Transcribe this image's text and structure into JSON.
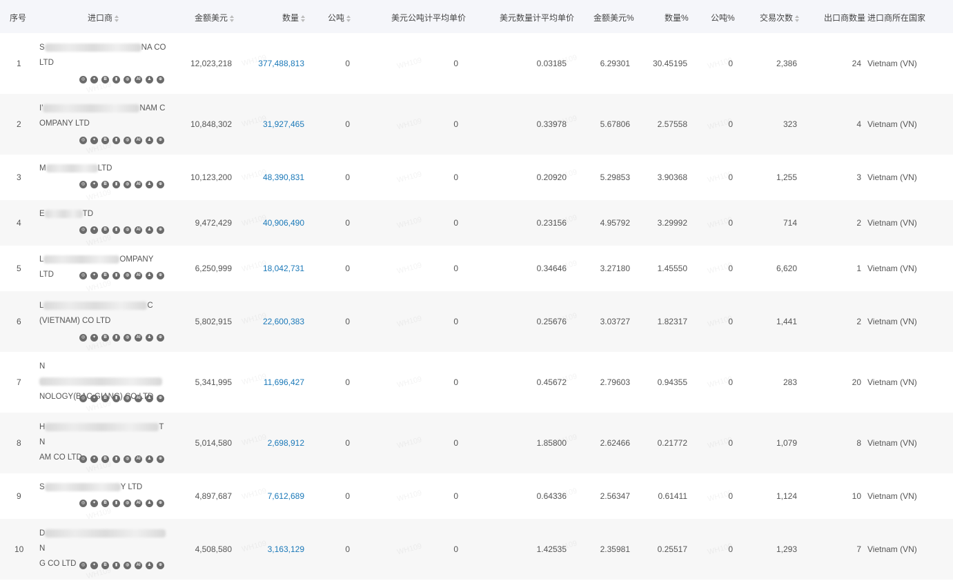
{
  "headers": {
    "idx": "序号",
    "importer": "进口商",
    "amount_usd": "金额美元",
    "quantity": "数量",
    "ton": "公吨",
    "usd_per_ton": "美元公吨计平均单价",
    "usd_per_qty": "美元数量计平均单价",
    "amount_pct": "金额美元%",
    "qty_pct": "数量%",
    "ton_pct": "公吨%",
    "trades": "交易次数",
    "exporters": "出口商数量",
    "country": "进口商所在国家"
  },
  "icon_names": [
    "locate-icon",
    "target-icon",
    "b-icon",
    "doc-icon",
    "globe-icon",
    "ai-icon",
    "users-icon",
    "web-icon"
  ],
  "watermark": "WH109",
  "rows": [
    {
      "idx": "1",
      "name1": "S",
      "name1b": "NA CO",
      "name2": "LTD",
      "amount": "12,023,218",
      "qty": "377,488,813",
      "ton": "0",
      "usd_ton": "0",
      "usd_qty": "0.03185",
      "amt_pct": "6.29301",
      "qty_pct": "30.45195",
      "ton_pct": "0",
      "trades": "2,386",
      "exporters": "24",
      "country": "Vietnam (VN)"
    },
    {
      "idx": "2",
      "name1": "I'",
      "name1b": "NAM C",
      "name2": "OMPANY LTD",
      "amount": "10,848,302",
      "qty": "31,927,465",
      "ton": "0",
      "usd_ton": "0",
      "usd_qty": "0.33978",
      "amt_pct": "5.67806",
      "qty_pct": "2.57558",
      "ton_pct": "0",
      "trades": "323",
      "exporters": "4",
      "country": "Vietnam (VN)"
    },
    {
      "idx": "3",
      "name1": "M",
      "name1b": "LTD",
      "name2": "",
      "amount": "10,123,200",
      "qty": "48,390,831",
      "ton": "0",
      "usd_ton": "0",
      "usd_qty": "0.20920",
      "amt_pct": "5.29853",
      "qty_pct": "3.90368",
      "ton_pct": "0",
      "trades": "1,255",
      "exporters": "3",
      "country": "Vietnam (VN)"
    },
    {
      "idx": "4",
      "name1": "E",
      "name1b": "TD",
      "name2": "",
      "amount": "9,472,429",
      "qty": "40,906,490",
      "ton": "0",
      "usd_ton": "0",
      "usd_qty": "0.23156",
      "amt_pct": "4.95792",
      "qty_pct": "3.29992",
      "ton_pct": "0",
      "trades": "714",
      "exporters": "2",
      "country": "Vietnam (VN)"
    },
    {
      "idx": "5",
      "name1": "L",
      "name1b": "OMPANY LTD",
      "name2": "",
      "amount": "6,250,999",
      "qty": "18,042,731",
      "ton": "0",
      "usd_ton": "0",
      "usd_qty": "0.34646",
      "amt_pct": "3.27180",
      "qty_pct": "1.45550",
      "ton_pct": "0",
      "trades": "6,620",
      "exporters": "1",
      "country": "Vietnam (VN)"
    },
    {
      "idx": "6",
      "name1": "L",
      "name1b": "C",
      "name2": "(VIETNAM) CO LTD",
      "amount": "5,802,915",
      "qty": "22,600,383",
      "ton": "0",
      "usd_ton": "0",
      "usd_qty": "0.25676",
      "amt_pct": "3.03727",
      "qty_pct": "1.82317",
      "ton_pct": "0",
      "trades": "1,441",
      "exporters": "2",
      "country": "Vietnam (VN)"
    },
    {
      "idx": "7",
      "name1": "N",
      "name1b": "",
      "name2": "NOLOGY(BAC GIANG) CO LTD",
      "amount": "5,341,995",
      "qty": "11,696,427",
      "ton": "0",
      "usd_ton": "0",
      "usd_qty": "0.45672",
      "amt_pct": "2.79603",
      "qty_pct": "0.94355",
      "ton_pct": "0",
      "trades": "283",
      "exporters": "20",
      "country": "Vietnam (VN)"
    },
    {
      "idx": "8",
      "name1": "H",
      "name1b": "T N",
      "name2": "AM CO LTD",
      "amount": "5,014,580",
      "qty": "2,698,912",
      "ton": "0",
      "usd_ton": "0",
      "usd_qty": "1.85800",
      "amt_pct": "2.62466",
      "qty_pct": "0.21772",
      "ton_pct": "0",
      "trades": "1,079",
      "exporters": "8",
      "country": "Vietnam (VN)"
    },
    {
      "idx": "9",
      "name1": "S",
      "name1b": "Y LTD",
      "name2": "",
      "amount": "4,897,687",
      "qty": "7,612,689",
      "ton": "0",
      "usd_ton": "0",
      "usd_qty": "0.64336",
      "amt_pct": "2.56347",
      "qty_pct": "0.61411",
      "ton_pct": "0",
      "trades": "1,124",
      "exporters": "10",
      "country": "Vietnam (VN)"
    },
    {
      "idx": "10",
      "name1": "D",
      "name1b": "N",
      "name2": "G CO LTD",
      "amount": "4,508,580",
      "qty": "3,163,129",
      "ton": "0",
      "usd_ton": "0",
      "usd_qty": "1.42535",
      "amt_pct": "2.35981",
      "qty_pct": "0.25517",
      "ton_pct": "0",
      "trades": "1,293",
      "exporters": "7",
      "country": "Vietnam (VN)"
    }
  ]
}
